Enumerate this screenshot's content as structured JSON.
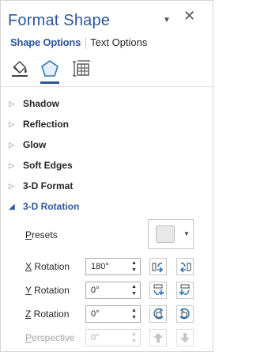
{
  "pane": {
    "title": "Format Shape",
    "dropdown_glyph": "▼",
    "close_glyph": "✕"
  },
  "tabs": [
    {
      "label": "Shape Options",
      "active": true
    },
    {
      "label": "Text Options",
      "active": false
    }
  ],
  "category_icons": [
    "fill-line-icon",
    "effects-icon",
    "size-properties-icon"
  ],
  "sections": [
    {
      "label": "Shadow",
      "expanded": false
    },
    {
      "label": "Reflection",
      "expanded": false
    },
    {
      "label": "Glow",
      "expanded": false
    },
    {
      "label": "Soft Edges",
      "expanded": false
    },
    {
      "label": "3-D Format",
      "expanded": false
    },
    {
      "label": "3-D Rotation",
      "expanded": true
    }
  ],
  "rotation": {
    "presets_label": "Presets",
    "x_label": "X Rotation",
    "x_value": "180°",
    "y_label": "Y Rotation",
    "y_value": "0°",
    "z_label": "Z Rotation",
    "z_value": "0°",
    "perspective_label": "Perspective",
    "perspective_value": "0°",
    "perspective_enabled": false
  },
  "colors": {
    "accent": "#2b579a",
    "icon_blue": "#2e75b6",
    "disabled": "#a6a6a6"
  }
}
